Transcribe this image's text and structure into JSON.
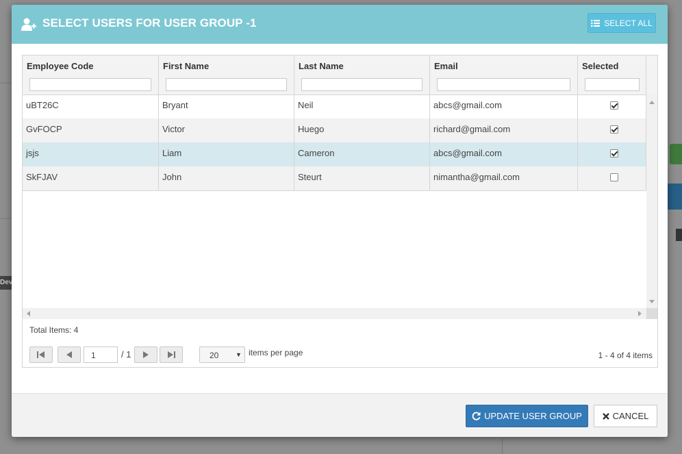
{
  "modal": {
    "title": "SELECT USERS FOR USER GROUP -1",
    "select_all_label": "SELECT ALL",
    "header_color": "#7ec8d3"
  },
  "grid": {
    "columns": [
      "Employee Code",
      "First Name",
      "Last Name",
      "Email",
      "Selected"
    ],
    "rows": [
      {
        "code": "uBT26C",
        "first": "Bryant",
        "last": "Neil",
        "email": "abcs@gmail.com",
        "selected": true
      },
      {
        "code": "GvFOCP",
        "first": "Victor",
        "last": "Huego",
        "email": "richard@gmail.com",
        "selected": true
      },
      {
        "code": "jsjs",
        "first": "Liam",
        "last": "Cameron",
        "email": "abcs@gmail.com",
        "selected": true
      },
      {
        "code": "SkFJAV",
        "first": "John",
        "last": "Steurt",
        "email": "nimantha@gmail.com",
        "selected": false
      }
    ],
    "total_items": "Total Items: 4"
  },
  "pager": {
    "page": "1",
    "of_pages": "/ 1",
    "page_size": "20",
    "items_per_page_label": "items per page",
    "range": "1 - 4 of 4 items"
  },
  "footer": {
    "update_label": "UPDATE USER GROUP",
    "cancel_label": "CANCEL"
  },
  "background": {
    "dev_label": "Dev"
  }
}
